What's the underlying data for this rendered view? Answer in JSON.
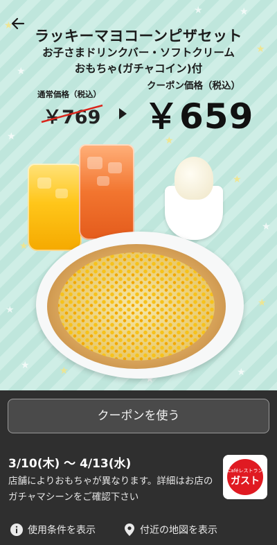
{
  "coupon": {
    "title_line1": "ラッキーマヨコーンピザセット",
    "title_line2": "お子さまドリンクバー・ソフトクリーム",
    "title_line3": "おもちゃ(ガチャコイン)付",
    "regular_label": "通常価格（税込）",
    "regular_price": "￥769",
    "coupon_label": "クーポン価格（税込）",
    "coupon_price": "￥659"
  },
  "actions": {
    "use_coupon_label": "クーポンを使う"
  },
  "info": {
    "dates": "3/10(木) 〜 4/13(水)",
    "notice": "店舗によりおもちゃが異なります。詳細はお店のガチャマシーンをご確認下さい"
  },
  "brand": {
    "logo_small": "Caféレストラン",
    "logo_main": "ガスト",
    "red": "#e01a22"
  },
  "links": {
    "terms": "使用条件を表示",
    "map": "付近の地図を表示"
  }
}
